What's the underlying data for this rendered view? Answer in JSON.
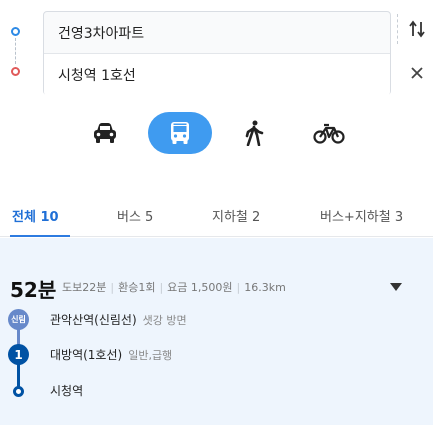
{
  "route": {
    "origin": "건영3차아파트",
    "destination": "시청역 1호선"
  },
  "modes": [
    {
      "id": "car",
      "icon": "car-icon",
      "active": false
    },
    {
      "id": "bus",
      "icon": "bus-icon",
      "active": true
    },
    {
      "id": "walk",
      "icon": "walking-icon",
      "active": false
    },
    {
      "id": "bike",
      "icon": "bicycle-icon",
      "active": false
    }
  ],
  "tabs": {
    "all": "전체 10",
    "bus": "버스 5",
    "subway": "지하철 2",
    "mixed": "버스+지하철 3"
  },
  "result": {
    "duration": "52분",
    "walk": "도보22분",
    "transfer": "환승1회",
    "fare": "요금 1,500원",
    "distance": "16.3km",
    "steps": [
      {
        "badge": "신림",
        "station": "관악산역(신림선)",
        "detail": "샛강 방면"
      },
      {
        "badge": "1",
        "station": "대방역(1호선)",
        "detail": "일반,급행"
      },
      {
        "station": "시청역"
      }
    ]
  },
  "colors": {
    "accent": "#3f9bf0",
    "shillim_line": "#6789ca",
    "line1": "#0052a4",
    "start_dot": "#2d8ae6",
    "end_dot": "#e05a5a"
  }
}
